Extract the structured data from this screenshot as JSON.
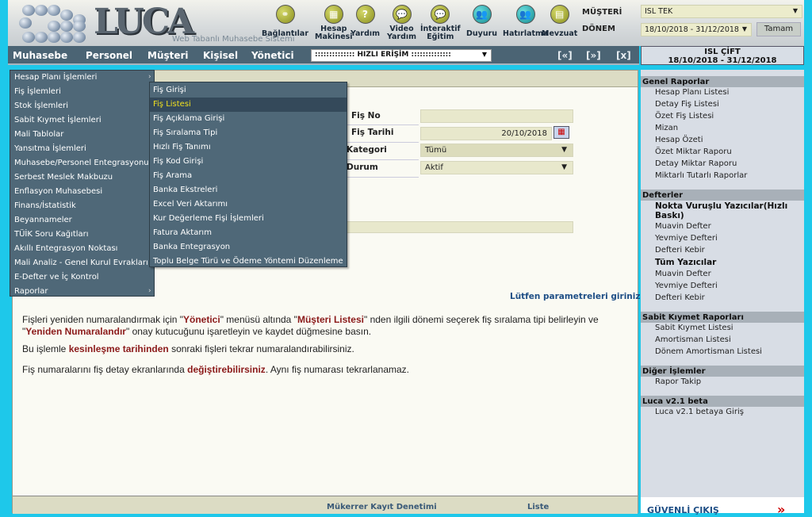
{
  "header": {
    "logo": "LUCA",
    "tagline": "Web Tabanlı Muhasebe Sistemi",
    "tools": [
      {
        "label": "Bağlantılar",
        "icon": "share-icon"
      },
      {
        "label": "Hesap Makinesi",
        "icon": "calculator-icon"
      },
      {
        "label": "Yardım",
        "icon": "help-icon"
      },
      {
        "label": "Video Yardım",
        "icon": "video-chat-icon"
      },
      {
        "label": "İnteraktif Eğitim",
        "icon": "chat-icon"
      },
      {
        "label": "Duyuru",
        "icon": "people-icon"
      },
      {
        "label": "Hatırlatma",
        "icon": "people-icon"
      },
      {
        "label": "Mevzuat",
        "icon": "document-icon"
      }
    ],
    "customer_label": "MÜŞTERİ",
    "customer_value": "ISL TEK",
    "period_label": "DÖNEM",
    "period_value": "18/10/2018 - 31/12/2018",
    "ok_button": "Tamam"
  },
  "nav": {
    "items": [
      "Muhasebe",
      "Personel",
      "Müşteri",
      "Kişisel",
      "Yönetici"
    ],
    "quick_access": ":::::::::::::: HIZLI ERİŞİM ::::::::::::::",
    "prev": "[«]",
    "next": "[»]",
    "close": "[x]"
  },
  "user": {
    "name": "ISL ÇİFT",
    "period": "18/10/2018 - 31/12/2018"
  },
  "menu": {
    "items": [
      {
        "label": "Hesap Planı İşlemleri",
        "arrow": "›"
      },
      {
        "label": "Fiş İşlemleri"
      },
      {
        "label": "Stok İşlemleri"
      },
      {
        "label": "Sabit Kıymet İşlemleri"
      },
      {
        "label": "Mali Tablolar"
      },
      {
        "label": "Yansıtma İşlemleri"
      },
      {
        "label": "Muhasebe/Personel Entegrasyonu"
      },
      {
        "label": "Serbest Meslek Makbuzu"
      },
      {
        "label": "Enflasyon Muhasebesi"
      },
      {
        "label": "Finans/İstatistik"
      },
      {
        "label": "Beyannameler"
      },
      {
        "label": "TÜİK Soru Kağıtları"
      },
      {
        "label": "Akıllı Entegrasyon Noktası"
      },
      {
        "label": "Mali Analiz - Genel Kurul Evrakları"
      },
      {
        "label": "E-Defter ve İç Kontrol"
      },
      {
        "label": "Raporlar",
        "arrow": "›"
      }
    ],
    "submenu": [
      "Fiş Girişi",
      "Fiş Listesi",
      "Fiş Açıklama Girişi",
      "Fiş Sıralama Tipi",
      "Hızlı Fiş Tanımı",
      "Fiş Kod Girişi",
      "Fiş Arama",
      "Banka Ekstreleri",
      "Excel Veri Aktarımı",
      "Kur Değerleme Fişi İşlemleri",
      "Fatura Aktarım",
      "Banka Entegrasyon",
      "Toplu Belge Türü ve Ödeme Yöntemi Düzenleme"
    ],
    "submenu_active": "Fiş Listesi"
  },
  "form": {
    "fis_no_label": "Fiş No",
    "fis_no_value": "",
    "fis_tarihi_label": "Fiş Tarihi",
    "fis_tarihi_value": "20/10/2018",
    "kategori_label": "Kategori",
    "kategori_value": "Tümü",
    "durum_label": "Durum",
    "durum_value": "Aktif",
    "hint": "Lütfen parametreleri giriniz"
  },
  "info": {
    "p1": [
      "Fişleri yeniden numaralandırmak için \"",
      "Yönetici",
      "\" menüsü altında \"",
      "Müşteri Listesi",
      "\" nden ilgili dönemi seçerek fiş sıralama tipi belirleyin ve \"",
      "Yeniden Numaralandır",
      "\" onay kutucuğunu işaretleyin ve kaydet düğmesine basın."
    ],
    "p2": [
      "Bu işlemle ",
      "kesinleşme tarihinden",
      " sonraki fişleri tekrar numaralandırabilirsiniz."
    ],
    "p3": [
      "Fiş numaralarını fiş detay ekranlarında ",
      "değiştirebilirsiniz",
      ". Aynı fiş numarası tekrarlanamaz."
    ]
  },
  "footer": {
    "duplicate_check": "Mükerrer Kayıt Denetimi",
    "list": "Liste"
  },
  "right_panel": {
    "sections": [
      {
        "title": "Genel Raporlar",
        "items": [
          {
            "label": "Hesap Planı Listesi"
          },
          {
            "label": "Detay Fiş Listesi"
          },
          {
            "label": "Özet Fiş Listesi"
          },
          {
            "label": "Mizan"
          },
          {
            "label": "Hesap Özeti"
          },
          {
            "label": "Özet Miktar Raporu"
          },
          {
            "label": "Detay Miktar Raporu"
          },
          {
            "label": "Miktarlı Tutarlı Raporlar"
          }
        ]
      },
      {
        "title": "Defterler",
        "items": [
          {
            "label": "Nokta Vuruşlu Yazıcılar(Hızlı Baskı)",
            "bold": true
          },
          {
            "label": "Muavin Defter"
          },
          {
            "label": "Yevmiye Defteri"
          },
          {
            "label": "Defteri Kebir"
          },
          {
            "label": "Tüm Yazıcılar",
            "bold": true
          },
          {
            "label": "Muavin Defter"
          },
          {
            "label": "Yevmiye Defteri"
          },
          {
            "label": "Defteri Kebir"
          }
        ]
      },
      {
        "title": "Sabit Kıymet Raporları",
        "items": [
          {
            "label": "Sabit Kıymet Listesi"
          },
          {
            "label": "Amortisman Listesi"
          },
          {
            "label": "Dönem Amortisman Listesi"
          }
        ]
      },
      {
        "title": "Diğer İşlemler",
        "items": [
          {
            "label": "Rapor Takip"
          }
        ]
      },
      {
        "title": "Luca v2.1 beta",
        "items": [
          {
            "label": "Luca v2.1 betaya Giriş"
          }
        ]
      }
    ],
    "logout": "GÜVENLİ ÇIKIŞ",
    "logout_arrow": "»"
  }
}
